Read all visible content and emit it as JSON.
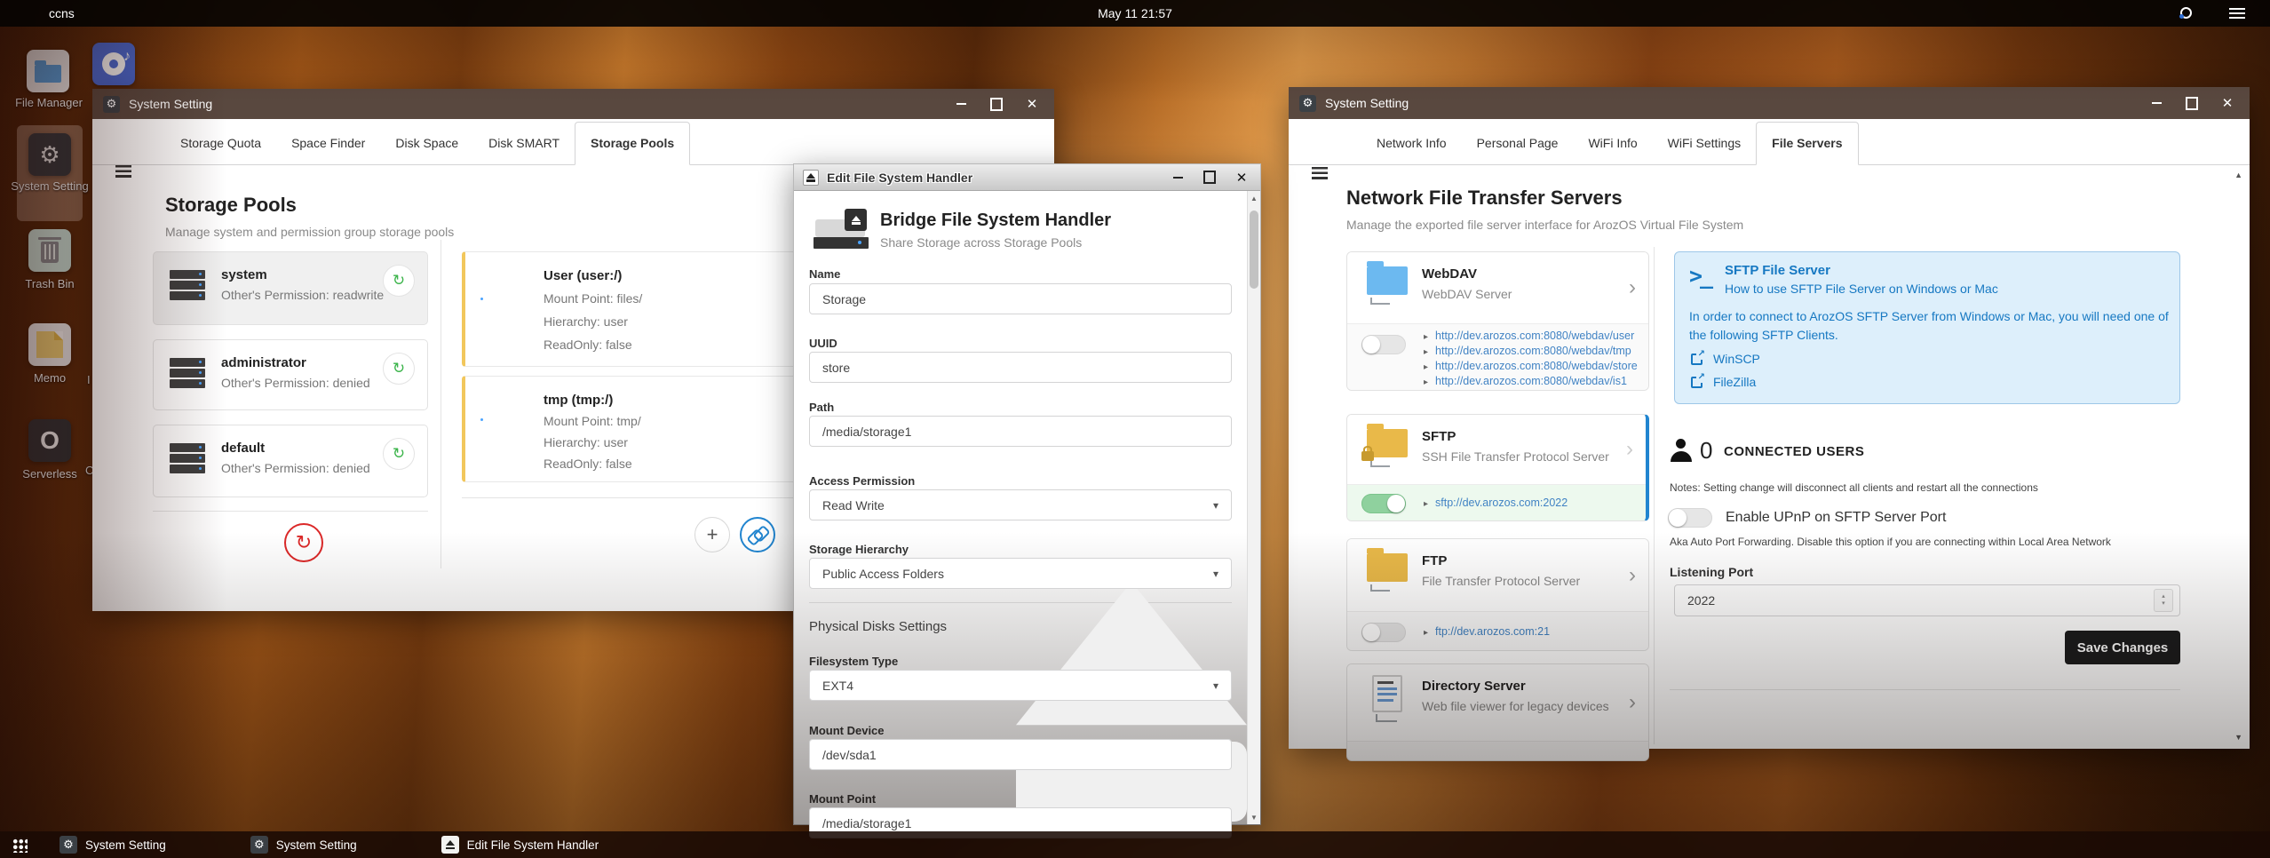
{
  "topbar": {
    "host": "ccns",
    "clock": "May 11 21:57"
  },
  "desktop": {
    "icons": [
      {
        "label": "File Manager"
      },
      {
        "label": "System Setting"
      },
      {
        "label": "Trash Bin"
      },
      {
        "label": "Memo"
      },
      {
        "label": "Serverless"
      }
    ],
    "partial_labels": [
      "I",
      "C"
    ]
  },
  "window_storage": {
    "title": "System Setting",
    "tabs": [
      "Storage Quota",
      "Space Finder",
      "Disk Space",
      "Disk SMART",
      "Storage Pools"
    ],
    "active_tab": "Storage Pools",
    "heading": "Storage Pools",
    "subheading": "Manage system and permission group storage pools",
    "pools": [
      {
        "name": "system",
        "permission": "Other's Permission: readwrite"
      },
      {
        "name": "administrator",
        "permission": "Other's Permission: denied"
      },
      {
        "name": "default",
        "permission": "Other's Permission: denied"
      }
    ],
    "mounts": [
      {
        "name": "User (user:/)",
        "mount": "Mount Point: files/",
        "hierarchy": "Hierarchy: user",
        "readonly": "ReadOnly: false"
      },
      {
        "name": "tmp (tmp:/)",
        "mount": "Mount Point: tmp/",
        "hierarchy": "Hierarchy: user",
        "readonly": "ReadOnly: false"
      }
    ]
  },
  "window_handler": {
    "title": "Edit File System Handler",
    "heading": "Bridge File System Handler",
    "subheading": "Share Storage across Storage Pools",
    "section": "Physical Disks Settings",
    "fields": {
      "name": {
        "label": "Name",
        "value": "Storage"
      },
      "uuid": {
        "label": "UUID",
        "value": "store"
      },
      "path": {
        "label": "Path",
        "value": "/media/storage1"
      },
      "access": {
        "label": "Access Permission",
        "value": "Read Write"
      },
      "hierarchy": {
        "label": "Storage Hierarchy",
        "value": "Public Access Folders"
      },
      "fstype": {
        "label": "Filesystem Type",
        "value": "EXT4"
      },
      "mount_device": {
        "label": "Mount Device",
        "value": "/dev/sda1"
      },
      "mount_point": {
        "label": "Mount Point",
        "value": "/media/storage1"
      }
    }
  },
  "window_servers": {
    "title": "System Setting",
    "tabs": [
      "Network Info",
      "Personal Page",
      "WiFi Info",
      "WiFi Settings",
      "File Servers"
    ],
    "active_tab": "File Servers",
    "heading": "Network File Transfer Servers",
    "subheading": "Manage the exported file server interface for ArozOS Virtual File System",
    "services": [
      {
        "name": "WebDAV",
        "desc": "WebDAV Server",
        "enabled": false,
        "links": [
          "http://dev.arozos.com:8080/webdav/user",
          "http://dev.arozos.com:8080/webdav/tmp",
          "http://dev.arozos.com:8080/webdav/store",
          "http://dev.arozos.com:8080/webdav/is1"
        ]
      },
      {
        "name": "SFTP",
        "desc": "SSH File Transfer Protocol Server",
        "enabled": true,
        "links": [
          "sftp://dev.arozos.com:2022"
        ]
      },
      {
        "name": "FTP",
        "desc": "File Transfer Protocol Server",
        "enabled": false,
        "links": [
          "ftp://dev.arozos.com:21"
        ]
      },
      {
        "name": "Directory Server",
        "desc": "Web file viewer for legacy devices"
      }
    ],
    "sftp_help": {
      "title": "SFTP File Server",
      "subtitle": "How to use SFTP File Server on Windows or Mac",
      "body": "In order to connect to ArozOS SFTP Server from Windows or Mac, you will need one of the following SFTP Clients.",
      "clients": [
        "WinSCP",
        "FileZilla"
      ]
    },
    "connected_users": {
      "count": "0",
      "label": "CONNECTED USERS",
      "notes": "Notes: Setting change will disconnect all clients and restart all the connections"
    },
    "upnp": {
      "label": "Enable UPnP on SFTP Server Port",
      "desc": "Aka Auto Port Forwarding. Disable this option if you are connecting within Local Area Network",
      "enabled": false
    },
    "listening_port": {
      "label": "Listening Port",
      "value": "2022"
    },
    "save_label": "Save Changes"
  },
  "taskbar": {
    "items": [
      {
        "label": "System Setting",
        "icon": "gear-icon"
      },
      {
        "label": "System Setting",
        "icon": "gear-icon"
      },
      {
        "label": "Edit File System Handler",
        "icon": "eject-icon"
      }
    ]
  },
  "colors": {
    "link_blue": "#4183c4",
    "accent_blue": "#2185d0",
    "info_blue": "#1678c2",
    "toggle_green": "#8fd19e",
    "mount_yellow": "#f2c75c",
    "danger_red": "#db2828",
    "save_dark": "#1b1c1d"
  }
}
